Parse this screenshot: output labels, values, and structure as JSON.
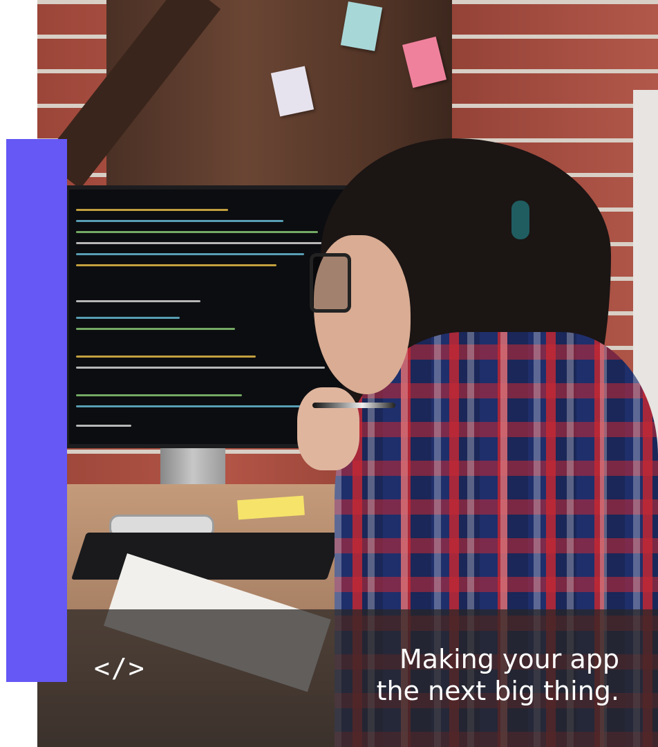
{
  "hero": {
    "tagline_line1": "Making your app",
    "tagline_line2": "the next big thing.",
    "icon": "code-brackets-icon",
    "icon_glyph": "</>",
    "accent_color": "#6558f5"
  }
}
